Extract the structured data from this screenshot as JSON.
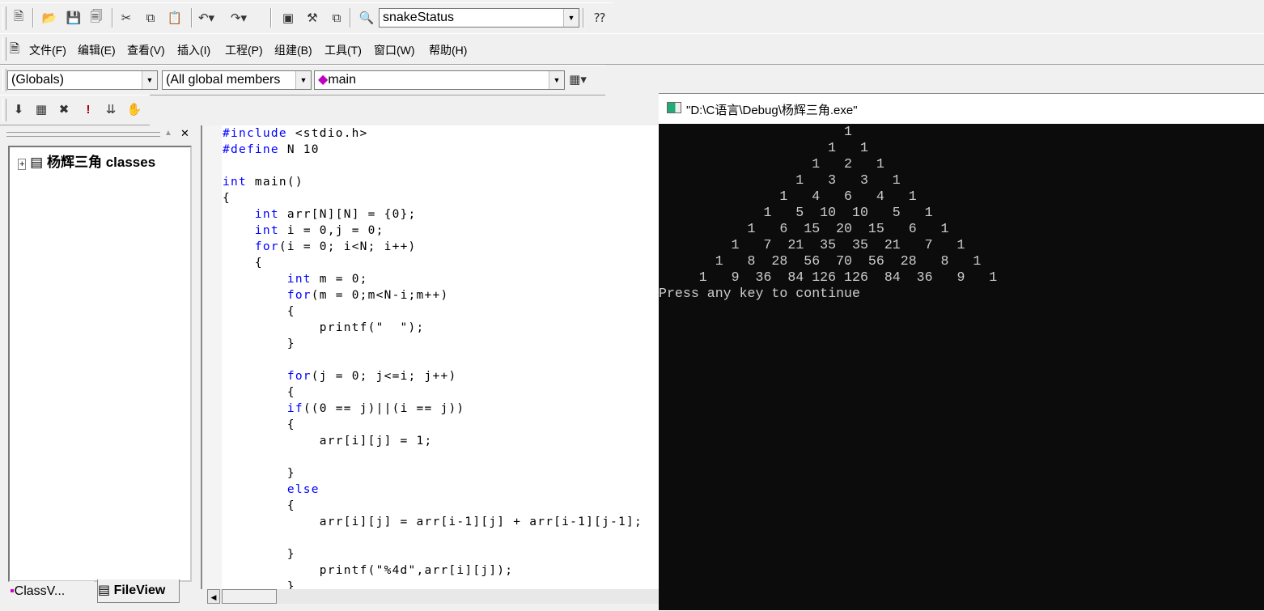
{
  "toolbar": {
    "find_combo": "snakeStatus",
    "icons": [
      "new-text-file-icon",
      "open-icon",
      "save-icon",
      "save-all-icon",
      "cut-icon",
      "copy-icon",
      "paste-icon",
      "undo-icon",
      "redo-icon",
      "workspace-icon",
      "output-icon",
      "window-list-icon",
      "find-in-files-icon",
      "search-icon"
    ]
  },
  "menu": [
    "文件(F)",
    "编辑(E)",
    "查看(V)",
    "插入(I)",
    "工程(P)",
    "组建(B)",
    "工具(T)",
    "窗口(W)",
    "帮助(H)"
  ],
  "wizardbar": {
    "scope": "(Globals)",
    "members": "(All global members",
    "function": "main"
  },
  "build_icons": [
    "compile-icon",
    "build-icon",
    "stop-build-icon",
    "execute-icon",
    "go-icon",
    "breakpoint-icon"
  ],
  "workspace": {
    "tree_root": "杨辉三角 classes",
    "tabs": [
      "ClassV...",
      "FileView"
    ]
  },
  "code_lines": [
    "#include <stdio.h>",
    "#define N 10",
    "",
    "int main()",
    "{",
    "    int arr[N][N] = {0};",
    "    int i = 0,j = 0;",
    "    for(i = 0; i<N; i++)",
    "    {",
    "        int m = 0;",
    "        for(m = 0;m<N-i;m++)",
    "        {",
    "            printf(\"  \");",
    "        }",
    "",
    "        for(j = 0; j<=i; j++)",
    "        {",
    "        if((0 == j)||(i == j))",
    "        {",
    "            arr[i][j] = 1;",
    "",
    "        }",
    "        else",
    "        {",
    "            arr[i][j] = arr[i-1][j] + arr[i-1][j-1];",
    "",
    "        }",
    "            printf(\"%4d\",arr[i][j]);",
    "        }"
  ],
  "console": {
    "title": "\"D:\\C语言\\Debug\\杨辉三角.exe\"",
    "rows": [
      [
        1
      ],
      [
        1,
        1
      ],
      [
        1,
        2,
        1
      ],
      [
        1,
        3,
        3,
        1
      ],
      [
        1,
        4,
        6,
        4,
        1
      ],
      [
        1,
        5,
        10,
        10,
        5,
        1
      ],
      [
        1,
        6,
        15,
        20,
        15,
        6,
        1
      ],
      [
        1,
        7,
        21,
        35,
        35,
        21,
        7,
        1
      ],
      [
        1,
        8,
        28,
        56,
        70,
        56,
        28,
        8,
        1
      ],
      [
        1,
        9,
        36,
        84,
        126,
        126,
        84,
        36,
        9,
        1
      ]
    ],
    "prompt": "Press any key to continue"
  },
  "colors": {
    "keyword": "#0000ff",
    "console_bg": "#0c0c0c",
    "console_text": "#cccccc"
  }
}
